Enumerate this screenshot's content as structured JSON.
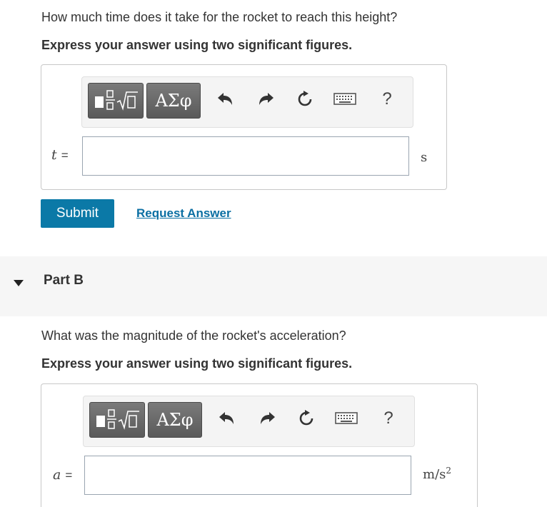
{
  "partA": {
    "question": "How much time does it take for the rocket to reach this height?",
    "instruction": "Express your answer using two significant figures.",
    "toolbar": {
      "greek_label": "ΑΣφ",
      "help_label": "?"
    },
    "variable": "t",
    "equals": "=",
    "input_value": "",
    "unit": "s",
    "submit_label": "Submit",
    "request_answer_label": "Request Answer"
  },
  "partB": {
    "header": "Part B",
    "question": "What was the magnitude of the rocket's acceleration?",
    "instruction": "Express your answer using two significant figures.",
    "toolbar": {
      "greek_label": "ΑΣφ",
      "help_label": "?"
    },
    "variable": "a",
    "equals": "=",
    "input_value": "",
    "unit": "m/s",
    "unit_exponent": "2"
  },
  "colors": {
    "submit_bg": "#0b79a7",
    "link": "#0b6fa3",
    "part_bar_bg": "#f6f6f6"
  },
  "icons": [
    "templates-icon",
    "greek-symbols-icon",
    "undo-icon",
    "redo-icon",
    "reset-icon",
    "keyboard-icon",
    "help-icon",
    "collapse-triangle-icon"
  ]
}
